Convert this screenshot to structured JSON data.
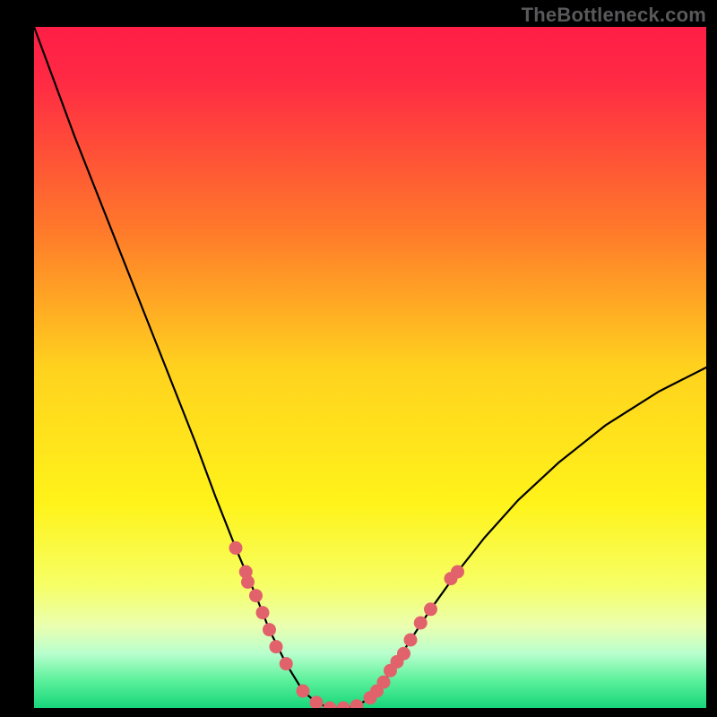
{
  "watermark": "TheBottleneck.com",
  "chart_data": {
    "type": "line",
    "title": "",
    "xlabel": "",
    "ylabel": "",
    "xlim": [
      0,
      100
    ],
    "ylim": [
      0,
      100
    ],
    "gradient_stops": [
      {
        "offset": 0.0,
        "color": "#ff1e46"
      },
      {
        "offset": 0.08,
        "color": "#ff2a44"
      },
      {
        "offset": 0.3,
        "color": "#ff7a2a"
      },
      {
        "offset": 0.5,
        "color": "#ffd21e"
      },
      {
        "offset": 0.7,
        "color": "#fff31a"
      },
      {
        "offset": 0.82,
        "color": "#f6ff66"
      },
      {
        "offset": 0.88,
        "color": "#eaffb0"
      },
      {
        "offset": 0.92,
        "color": "#b8ffce"
      },
      {
        "offset": 0.96,
        "color": "#5af09a"
      },
      {
        "offset": 1.0,
        "color": "#17d67a"
      }
    ],
    "series": [
      {
        "name": "bottleneck-curve",
        "x": [
          0.0,
          3.0,
          6.0,
          9.0,
          12.0,
          15.0,
          18.0,
          21.0,
          24.0,
          27.0,
          30.0,
          33.0,
          35.0,
          37.5,
          40.0,
          42.0,
          44.0,
          46.0,
          48.0,
          50.0,
          52.0,
          54.0,
          56.0,
          59.0,
          63.0,
          67.0,
          72.0,
          78.0,
          85.0,
          93.0,
          100.0
        ],
        "y": [
          100.0,
          92.0,
          84.0,
          76.5,
          69.0,
          61.5,
          54.0,
          46.5,
          39.0,
          31.0,
          23.5,
          16.5,
          11.5,
          6.5,
          2.5,
          0.8,
          0.0,
          0.0,
          0.3,
          1.5,
          3.8,
          6.8,
          10.0,
          14.5,
          20.0,
          25.0,
          30.5,
          36.0,
          41.5,
          46.5,
          50.0
        ]
      }
    ],
    "markers": {
      "name": "highlighted-points",
      "color": "#e2626c",
      "points": [
        {
          "x": 30.0,
          "y": 23.5
        },
        {
          "x": 31.5,
          "y": 20.0
        },
        {
          "x": 31.8,
          "y": 18.5
        },
        {
          "x": 33.0,
          "y": 16.5
        },
        {
          "x": 34.0,
          "y": 14.0
        },
        {
          "x": 35.0,
          "y": 11.5
        },
        {
          "x": 36.0,
          "y": 9.0
        },
        {
          "x": 37.5,
          "y": 6.5
        },
        {
          "x": 40.0,
          "y": 2.5
        },
        {
          "x": 42.0,
          "y": 0.8
        },
        {
          "x": 44.0,
          "y": 0.0
        },
        {
          "x": 46.0,
          "y": 0.0
        },
        {
          "x": 48.0,
          "y": 0.3
        },
        {
          "x": 50.0,
          "y": 1.5
        },
        {
          "x": 51.0,
          "y": 2.5
        },
        {
          "x": 52.0,
          "y": 3.8
        },
        {
          "x": 53.0,
          "y": 5.5
        },
        {
          "x": 54.0,
          "y": 6.8
        },
        {
          "x": 55.0,
          "y": 8.0
        },
        {
          "x": 56.0,
          "y": 10.0
        },
        {
          "x": 57.5,
          "y": 12.5
        },
        {
          "x": 59.0,
          "y": 14.5
        },
        {
          "x": 62.0,
          "y": 19.0
        },
        {
          "x": 63.0,
          "y": 20.0
        }
      ]
    }
  }
}
